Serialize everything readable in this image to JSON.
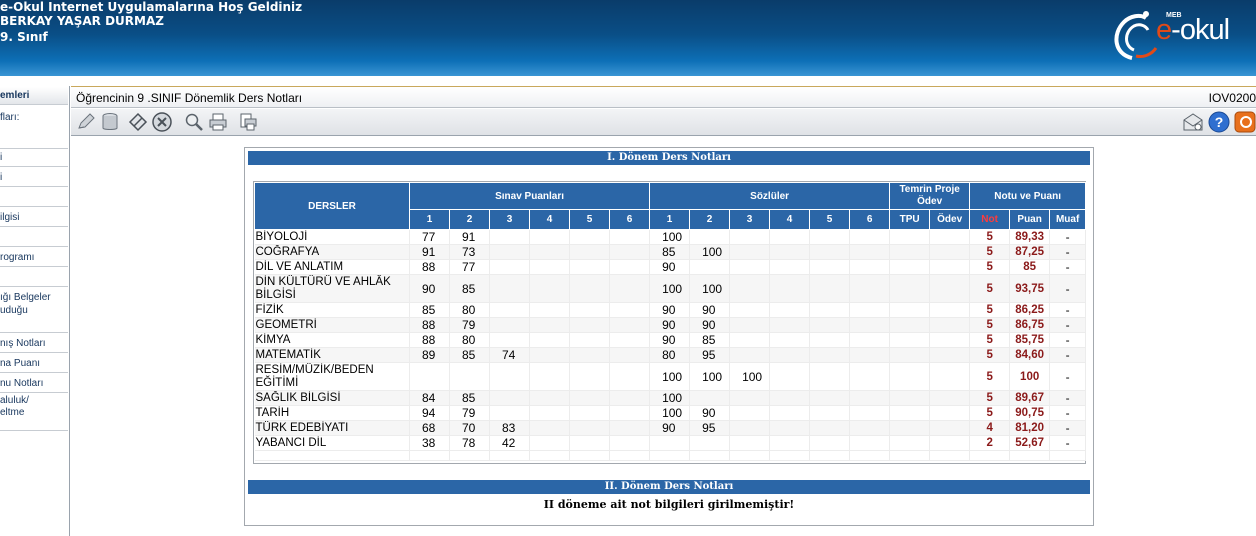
{
  "header": {
    "welcome": "e-Okul Internet Uygulamalarına Hoş Geldiniz",
    "student_name": "BERKAY YAŞAR DURMAZ",
    "class": "9. Sınıf",
    "logo": {
      "meb": "MEB",
      "e": "e",
      "dash": "-",
      "okul": "okul"
    }
  },
  "sidebar": {
    "items": [
      "emleri",
      "fları:",
      "",
      "i",
      "i",
      "",
      "ilgisi",
      "",
      "rogramı",
      "",
      "ığı Belgeler",
      "uduğu",
      "nış Notları",
      "na Puanı",
      "nu Notları",
      "aluluk/",
      "eltme"
    ]
  },
  "page": {
    "title": "Öğrencinin  9 .SINIF  Dönemlik Ders Notları",
    "code": "IOV0200"
  },
  "toolbar": {
    "icons": [
      "edit-icon",
      "database-icon",
      "eraser-icon",
      "cancel-icon",
      "search-icon",
      "print-icon",
      "print-preview-icon",
      "mail-icon",
      "help-icon",
      "exit-icon"
    ]
  },
  "term1": {
    "title": "I. Dönem Ders Notları",
    "headers": {
      "courses": "DERSLER",
      "exam": "Sınav Puanları",
      "oral": "Sözlüler",
      "project": "Temrin Proje Ödev",
      "result": "Notu ve Puanı",
      "numbers": [
        "1",
        "2",
        "3",
        "4",
        "5",
        "6"
      ],
      "tpu": "TPU",
      "odev": "Ödev",
      "not": "Not",
      "puan": "Puan",
      "muaf": "Muaf"
    },
    "rows": [
      {
        "course": "BİYOLOJİ",
        "exams": [
          "77",
          "91",
          "",
          "",
          "",
          ""
        ],
        "orals": [
          "100",
          "",
          "",
          "",
          "",
          ""
        ],
        "tpu": "",
        "odev": "",
        "not": "5",
        "puan": "89,33",
        "muaf": "-"
      },
      {
        "course": "COĞRAFYA",
        "exams": [
          "91",
          "73",
          "",
          "",
          "",
          ""
        ],
        "orals": [
          "85",
          "100",
          "",
          "",
          "",
          ""
        ],
        "tpu": "",
        "odev": "",
        "not": "5",
        "puan": "87,25",
        "muaf": "-"
      },
      {
        "course": "DİL VE ANLATIM",
        "exams": [
          "88",
          "77",
          "",
          "",
          "",
          ""
        ],
        "orals": [
          "90",
          "",
          "",
          "",
          "",
          ""
        ],
        "tpu": "",
        "odev": "",
        "not": "5",
        "puan": "85",
        "muaf": "-"
      },
      {
        "course": "DİN KÜLTÜRÜ VE AHLÂK BİLGİSİ",
        "exams": [
          "90",
          "85",
          "",
          "",
          "",
          ""
        ],
        "orals": [
          "100",
          "100",
          "",
          "",
          "",
          ""
        ],
        "tpu": "",
        "odev": "",
        "not": "5",
        "puan": "93,75",
        "muaf": "-"
      },
      {
        "course": "FİZİK",
        "exams": [
          "85",
          "80",
          "",
          "",
          "",
          ""
        ],
        "orals": [
          "90",
          "90",
          "",
          "",
          "",
          ""
        ],
        "tpu": "",
        "odev": "",
        "not": "5",
        "puan": "86,25",
        "muaf": "-"
      },
      {
        "course": "GEOMETRİ",
        "exams": [
          "88",
          "79",
          "",
          "",
          "",
          ""
        ],
        "orals": [
          "90",
          "90",
          "",
          "",
          "",
          ""
        ],
        "tpu": "",
        "odev": "",
        "not": "5",
        "puan": "86,75",
        "muaf": "-"
      },
      {
        "course": "KİMYA",
        "exams": [
          "88",
          "80",
          "",
          "",
          "",
          ""
        ],
        "orals": [
          "90",
          "85",
          "",
          "",
          "",
          ""
        ],
        "tpu": "",
        "odev": "",
        "not": "5",
        "puan": "85,75",
        "muaf": "-"
      },
      {
        "course": "MATEMATİK",
        "exams": [
          "89",
          "85",
          "74",
          "",
          "",
          ""
        ],
        "orals": [
          "80",
          "95",
          "",
          "",
          "",
          ""
        ],
        "tpu": "",
        "odev": "",
        "not": "5",
        "puan": "84,60",
        "muaf": "-"
      },
      {
        "course": "RESİM/MÜZİK/BEDEN EĞİTİMİ",
        "exams": [
          "",
          "",
          "",
          "",
          "",
          ""
        ],
        "orals": [
          "100",
          "100",
          "100",
          "",
          "",
          ""
        ],
        "tpu": "",
        "odev": "",
        "not": "5",
        "puan": "100",
        "muaf": "-"
      },
      {
        "course": "SAĞLIK BİLGİSİ",
        "exams": [
          "84",
          "85",
          "",
          "",
          "",
          ""
        ],
        "orals": [
          "100",
          "",
          "",
          "",
          "",
          ""
        ],
        "tpu": "",
        "odev": "",
        "not": "5",
        "puan": "89,67",
        "muaf": "-"
      },
      {
        "course": "TARİH",
        "exams": [
          "94",
          "79",
          "",
          "",
          "",
          ""
        ],
        "orals": [
          "100",
          "90",
          "",
          "",
          "",
          ""
        ],
        "tpu": "",
        "odev": "",
        "not": "5",
        "puan": "90,75",
        "muaf": "-"
      },
      {
        "course": "TÜRK EDEBİYATI",
        "exams": [
          "68",
          "70",
          "83",
          "",
          "",
          ""
        ],
        "orals": [
          "90",
          "95",
          "",
          "",
          "",
          ""
        ],
        "tpu": "",
        "odev": "",
        "not": "4",
        "puan": "81,20",
        "muaf": "-"
      },
      {
        "course": "YABANCI DİL",
        "exams": [
          "38",
          "78",
          "42",
          "",
          "",
          ""
        ],
        "orals": [
          "",
          "",
          "",
          "",
          "",
          ""
        ],
        "tpu": "",
        "odev": "",
        "not": "2",
        "puan": "52,67",
        "muaf": "-"
      }
    ]
  },
  "term2": {
    "title": "II. Dönem Ders Notları",
    "message": "II döneme ait not bilgileri girilmemiştir!"
  }
}
